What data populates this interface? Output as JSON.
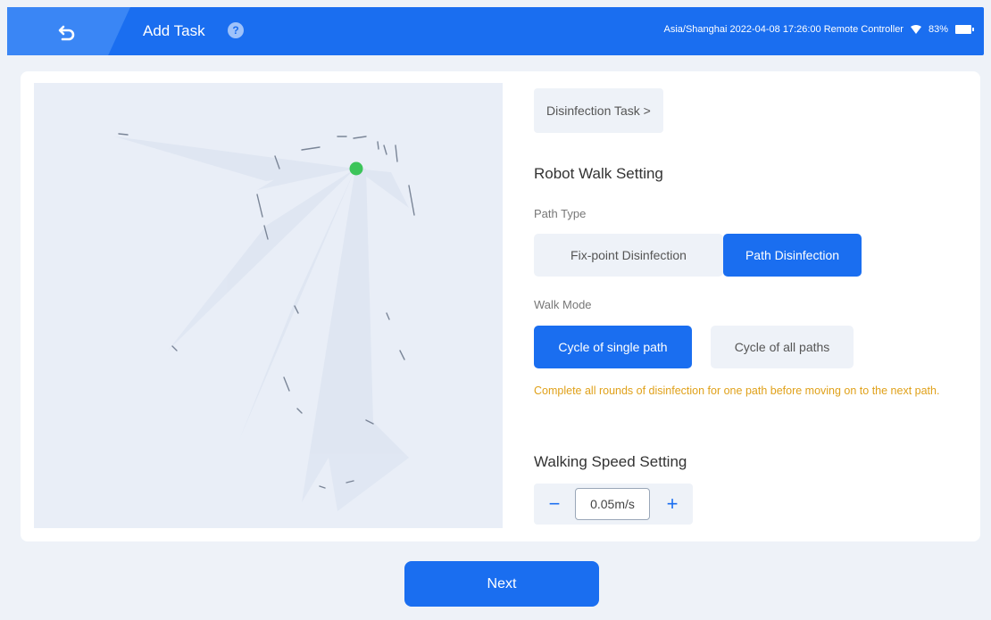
{
  "header": {
    "title": "Add Task",
    "help_icon": "?",
    "status_text": "Asia/Shanghai 2022-04-08 17:26:00  Remote Controller",
    "battery": "83%"
  },
  "task": {
    "breadcrumb": "Disinfection Task >"
  },
  "walk_setting": {
    "title": "Robot Walk Setting",
    "path_type_label": "Path Type",
    "path_types": [
      "Fix-point Disinfection",
      "Path Disinfection"
    ],
    "path_type_selected": "Path Disinfection",
    "walk_mode_label": "Walk Mode",
    "walk_modes": [
      "Cycle of single path",
      "Cycle of all paths"
    ],
    "walk_mode_selected": "Cycle of single path",
    "hint": "Complete all rounds of disinfection for one path before moving on to the next path."
  },
  "speed": {
    "title": "Walking Speed Setting",
    "value": "0.05m/s",
    "minus": "−",
    "plus": "+"
  },
  "footer": {
    "next_label": "Next"
  },
  "colors": {
    "primary": "#1a6ef0",
    "hint": "#e0a11a",
    "robot_marker": "#3cc45a"
  }
}
